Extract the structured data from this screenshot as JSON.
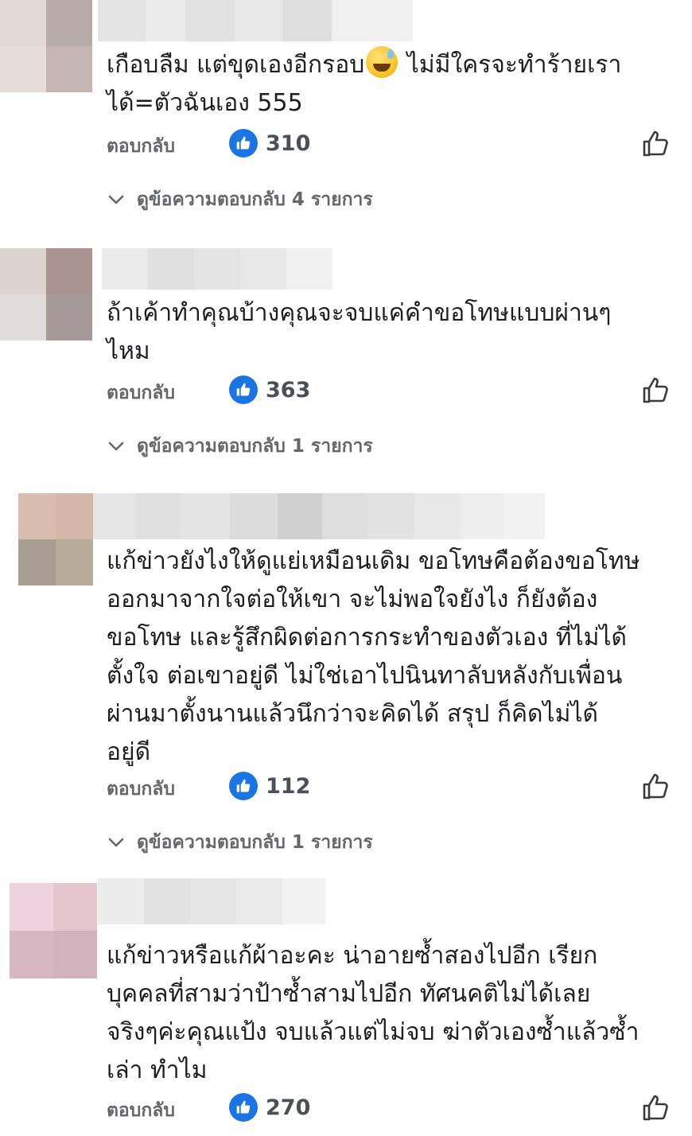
{
  "comments": [
    {
      "text_before_emoji": "เกือบลืม แต่ขุดเองอีกรอบ",
      "emoji": "grinning-face-with-sweat-emoji",
      "text_after_emoji": " ไม่มีใครจะทำร้ายเรา\nได้=ตัวฉันเอง 555",
      "reply_label": "ตอบกลับ",
      "like_count": "310",
      "view_replies_label": "ดูข้อความตอบกลับ 4 รายการ"
    },
    {
      "text": "ถ้าเค้าทำคุณบ้างคุณจะจบแค่คำขอโทษแบบผ่านๆ\nไหม",
      "reply_label": "ตอบกลับ",
      "like_count": "363",
      "view_replies_label": "ดูข้อความตอบกลับ 1 รายการ"
    },
    {
      "text": "แก้ข่าวยังไงให้ดูแย่เหมือนเดิม ขอโทษคือต้องขอโทษ\nออกมาจากใจต่อให้เขา จะไม่พอใจยังไง ก็ยังต้อง\nขอโทษ และรู้สึกผิดต่อการกระทำของตัวเอง ที่ไม่ได้\nตั้งใจ ต่อเขาอยู่ดี ไม่ใช่เอาไปนินทาลับหลังกับเพื่อน\nผ่านมาตั้งนานแล้วนึกว่าจะคิดได้ สรุป ก็คิดไม่ได้\nอยู่ดี",
      "reply_label": "ตอบกลับ",
      "like_count": "112",
      "view_replies_label": "ดูข้อความตอบกลับ 1 รายการ"
    },
    {
      "text": "แก้ข่าวหรือแก้ผ้าอะคะ น่าอายซ้ำสองไปอีก เรียก\nบุคคลที่สามว่าป้าซ้ำสามไปอีก ทัศนคติไม่ได้เลย\nจริงๆค่ะคุณแป้ง จบแล้วแต่ไม่จบ ฆ่าตัวเองซ้ำแล้วซ้ำ\nเล่า ทำไม",
      "reply_label": "ตอบกลับ",
      "like_count": "270"
    }
  ],
  "colors": {
    "like_badge": "#1b74e4",
    "secondary_text": "#65676b",
    "primary_text": "#1c1e21"
  },
  "icons": {
    "like_badge": "thumbs-up-icon",
    "like_button": "thumbs-up-outline-icon",
    "view_replies": "chevron-down-icon"
  }
}
